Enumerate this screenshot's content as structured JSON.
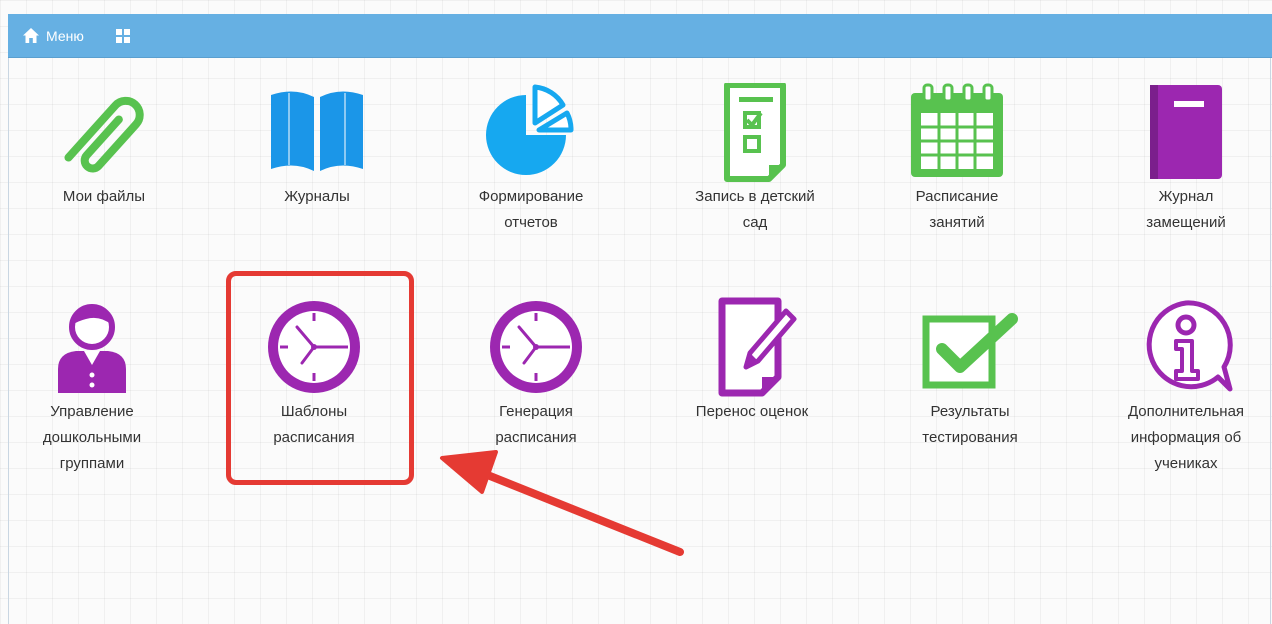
{
  "topbar": {
    "menu_label": "Меню",
    "home_icon": "home-icon",
    "grid_icon": "grid-icon",
    "color": "#66b0e3"
  },
  "tiles": [
    {
      "label": "Мои файлы",
      "icon": "paperclip-icon",
      "color": "#58c24f"
    },
    {
      "label": "Журналы",
      "icon": "open-book-icon",
      "color": "#1b96e8"
    },
    {
      "label": "Формирование\nотчетов",
      "icon": "pie-chart-icon",
      "color": "#16a8f0"
    },
    {
      "label": "Запись в детский\nсад",
      "icon": "checklist-document-icon",
      "color": "#58c24f"
    },
    {
      "label": "Расписание\nзанятий",
      "icon": "calendar-icon",
      "color": "#58c24f"
    },
    {
      "label": "Журнал\nзамещений",
      "icon": "journal-book-icon",
      "color": "#9c27b0"
    },
    {
      "label": "Управление\nдошкольными\nгруппами",
      "icon": "person-icon",
      "color": "#9c27b0"
    },
    {
      "label": "Шаблоны\nрасписания",
      "icon": "clock-icon",
      "color": "#9c27b0"
    },
    {
      "label": "Генерация\nрасписания",
      "icon": "clock-icon",
      "color": "#9c27b0"
    },
    {
      "label": "Перенос оценок",
      "icon": "document-pencil-icon",
      "color": "#9c27b0"
    },
    {
      "label": "Результаты\nтестирования",
      "icon": "checkbox-check-icon",
      "color": "#58c24f"
    },
    {
      "label": "Дополнительная\nинформация об\nучениках",
      "icon": "info-bubble-icon",
      "color": "#9c27b0"
    }
  ],
  "annotation": {
    "highlight_color": "#e53a33",
    "highlighted_tile": "Шаблоны\nрасписания"
  }
}
